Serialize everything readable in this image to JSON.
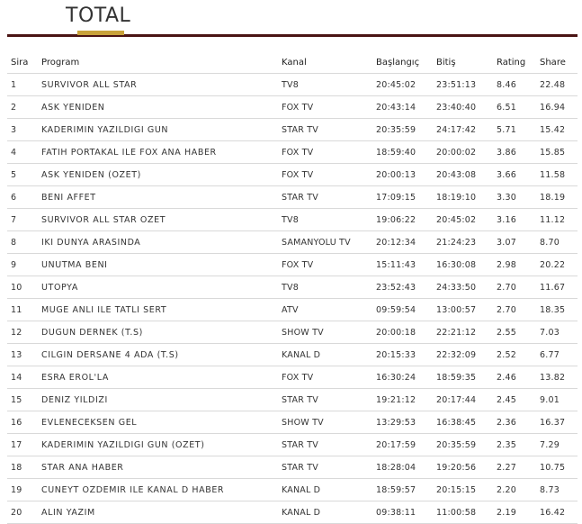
{
  "page": {
    "title": "TOTAL"
  },
  "table": {
    "headers": {
      "sira": "Sira",
      "program": "Program",
      "kanal": "Kanal",
      "baslangic": "Başlangıç",
      "bitis": "Bitiş",
      "rating": "Rating",
      "share": "Share"
    },
    "rows": [
      {
        "sira": "1",
        "program": "SURVIVOR ALL STAR",
        "kanal": "TV8",
        "baslangic": "20:45:02",
        "bitis": "23:51:13",
        "rating": "8.46",
        "share": "22.48"
      },
      {
        "sira": "2",
        "program": "ASK YENIDEN",
        "kanal": "FOX TV",
        "baslangic": "20:43:14",
        "bitis": "23:40:40",
        "rating": "6.51",
        "share": "16.94"
      },
      {
        "sira": "3",
        "program": "KADERIMIN YAZILDIGI GUN",
        "kanal": "STAR TV",
        "baslangic": "20:35:59",
        "bitis": "24:17:42",
        "rating": "5.71",
        "share": "15.42"
      },
      {
        "sira": "4",
        "program": "FATIH PORTAKAL ILE FOX ANA HABER",
        "kanal": "FOX TV",
        "baslangic": "18:59:40",
        "bitis": "20:00:02",
        "rating": "3.86",
        "share": "15.85"
      },
      {
        "sira": "5",
        "program": "ASK YENIDEN (OZET)",
        "kanal": "FOX TV",
        "baslangic": "20:00:13",
        "bitis": "20:43:08",
        "rating": "3.66",
        "share": "11.58"
      },
      {
        "sira": "6",
        "program": "BENI AFFET",
        "kanal": "STAR TV",
        "baslangic": "17:09:15",
        "bitis": "18:19:10",
        "rating": "3.30",
        "share": "18.19"
      },
      {
        "sira": "7",
        "program": "SURVIVOR ALL STAR OZET",
        "kanal": "TV8",
        "baslangic": "19:06:22",
        "bitis": "20:45:02",
        "rating": "3.16",
        "share": "11.12"
      },
      {
        "sira": "8",
        "program": "IKI DUNYA ARASINDA",
        "kanal": "SAMANYOLU TV",
        "baslangic": "20:12:34",
        "bitis": "21:24:23",
        "rating": "3.07",
        "share": "8.70"
      },
      {
        "sira": "9",
        "program": "UNUTMA BENI",
        "kanal": "FOX TV",
        "baslangic": "15:11:43",
        "bitis": "16:30:08",
        "rating": "2.98",
        "share": "20.22"
      },
      {
        "sira": "10",
        "program": "UTOPYA",
        "kanal": "TV8",
        "baslangic": "23:52:43",
        "bitis": "24:33:50",
        "rating": "2.70",
        "share": "11.67"
      },
      {
        "sira": "11",
        "program": "MUGE ANLI ILE TATLI SERT",
        "kanal": "ATV",
        "baslangic": "09:59:54",
        "bitis": "13:00:57",
        "rating": "2.70",
        "share": "18.35"
      },
      {
        "sira": "12",
        "program": "DUGUN DERNEK (T.S)",
        "kanal": "SHOW TV",
        "baslangic": "20:00:18",
        "bitis": "22:21:12",
        "rating": "2.55",
        "share": "7.03"
      },
      {
        "sira": "13",
        "program": "CILGIN DERSANE 4 ADA (T.S)",
        "kanal": "KANAL D",
        "baslangic": "20:15:33",
        "bitis": "22:32:09",
        "rating": "2.52",
        "share": "6.77"
      },
      {
        "sira": "14",
        "program": "ESRA EROL'LA",
        "kanal": "FOX TV",
        "baslangic": "16:30:24",
        "bitis": "18:59:35",
        "rating": "2.46",
        "share": "13.82"
      },
      {
        "sira": "15",
        "program": "DENIZ YILDIZI",
        "kanal": "STAR TV",
        "baslangic": "19:21:12",
        "bitis": "20:17:44",
        "rating": "2.45",
        "share": "9.01"
      },
      {
        "sira": "16",
        "program": "EVLENECEKSEN GEL",
        "kanal": "SHOW TV",
        "baslangic": "13:29:53",
        "bitis": "16:38:45",
        "rating": "2.36",
        "share": "16.37"
      },
      {
        "sira": "17",
        "program": "KADERIMIN YAZILDIGI GUN (OZET)",
        "kanal": "STAR TV",
        "baslangic": "20:17:59",
        "bitis": "20:35:59",
        "rating": "2.35",
        "share": "7.29"
      },
      {
        "sira": "18",
        "program": "STAR ANA HABER",
        "kanal": "STAR TV",
        "baslangic": "18:28:04",
        "bitis": "19:20:56",
        "rating": "2.27",
        "share": "10.75"
      },
      {
        "sira": "19",
        "program": "CUNEYT OZDEMIR ILE KANAL D HABER",
        "kanal": "KANAL D",
        "baslangic": "18:59:57",
        "bitis": "20:15:15",
        "rating": "2.20",
        "share": "8.73"
      },
      {
        "sira": "20",
        "program": "ALIN YAZIM",
        "kanal": "KANAL D",
        "baslangic": "09:38:11",
        "bitis": "11:00:58",
        "rating": "2.19",
        "share": "16.42"
      }
    ]
  },
  "colors": {
    "accent_underline": "#c8a23a",
    "header_rule": "#4a1414",
    "row_border": "#d9d9d9",
    "text": "#333333"
  }
}
